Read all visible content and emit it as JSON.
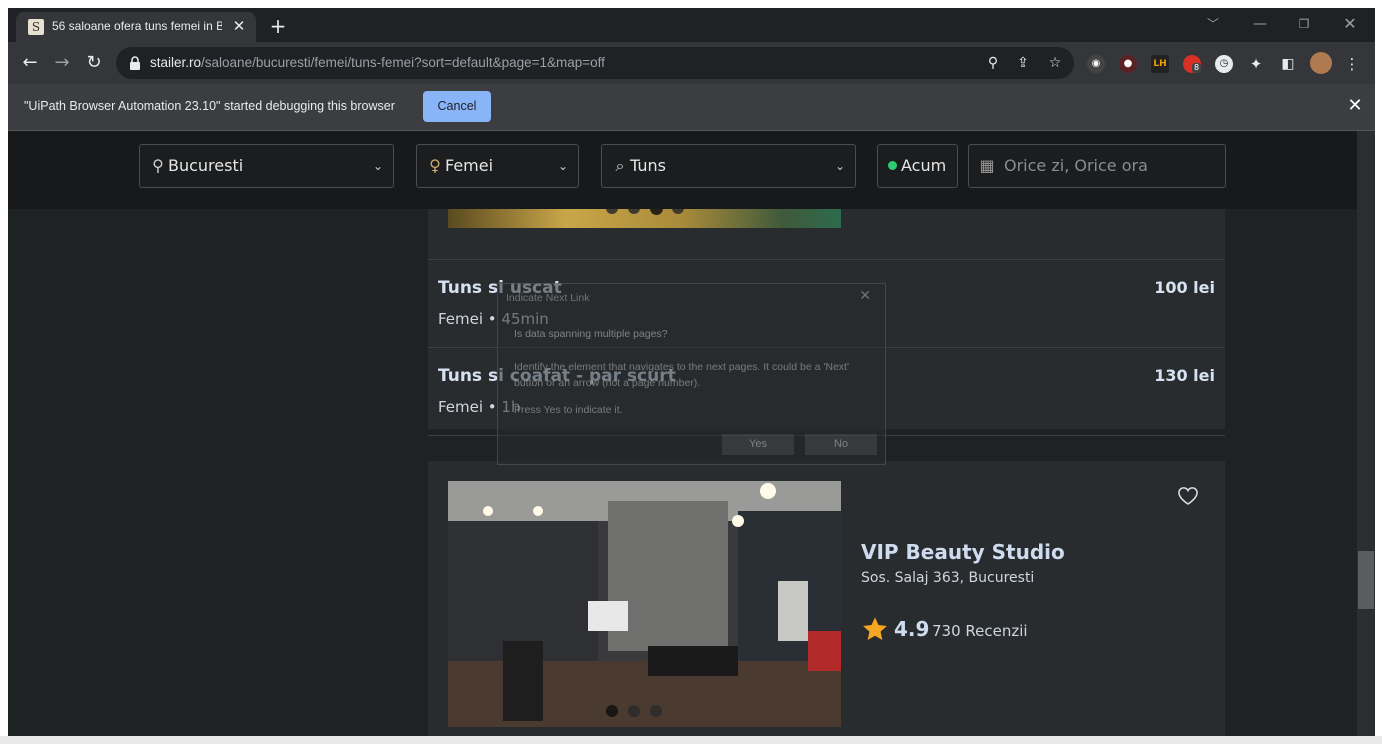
{
  "browser": {
    "tab_title": "56 saloane ofera tuns femei in B",
    "tab_favicon": "S",
    "url_host": "stailer.ro",
    "url_path": "/saloane/bucuresti/femei/tuns-femei?sort=default&page=1&map=off"
  },
  "debug_bar": {
    "message": "\"UiPath Browser Automation 23.10\" started debugging this browser",
    "cancel_label": "Cancel"
  },
  "filters": {
    "location": "Bucuresti",
    "gender": "Femei",
    "service": "Tuns",
    "now": "Acum",
    "date_placeholder": "Orice zi, Orice ora"
  },
  "services": [
    {
      "name": "Tuns si uscat",
      "meta": "Femei • 45min",
      "price": "100 lei"
    },
    {
      "name": "Tuns si coafat - par scurt",
      "meta": "Femei • 1h",
      "price": "130 lei"
    }
  ],
  "dialog": {
    "title": "Indicate Next Link",
    "question": "Is data spanning multiple pages?",
    "description": "Identify the element that navigates to the next pages. It could be a 'Next' button or an arrow (not a page number).",
    "press": "Press Yes to indicate it.",
    "yes": "Yes",
    "no": "No"
  },
  "salon": {
    "name": "VIP Beauty Studio",
    "address": "Sos. Salaj 363, Bucuresti",
    "rating": "4.9",
    "reviews": "730 Recenzii"
  },
  "ext_badge": "8",
  "colors": {
    "accent_blue": "#8ab4f8",
    "now_green": "#2ecc71",
    "star": "#f5a623"
  }
}
